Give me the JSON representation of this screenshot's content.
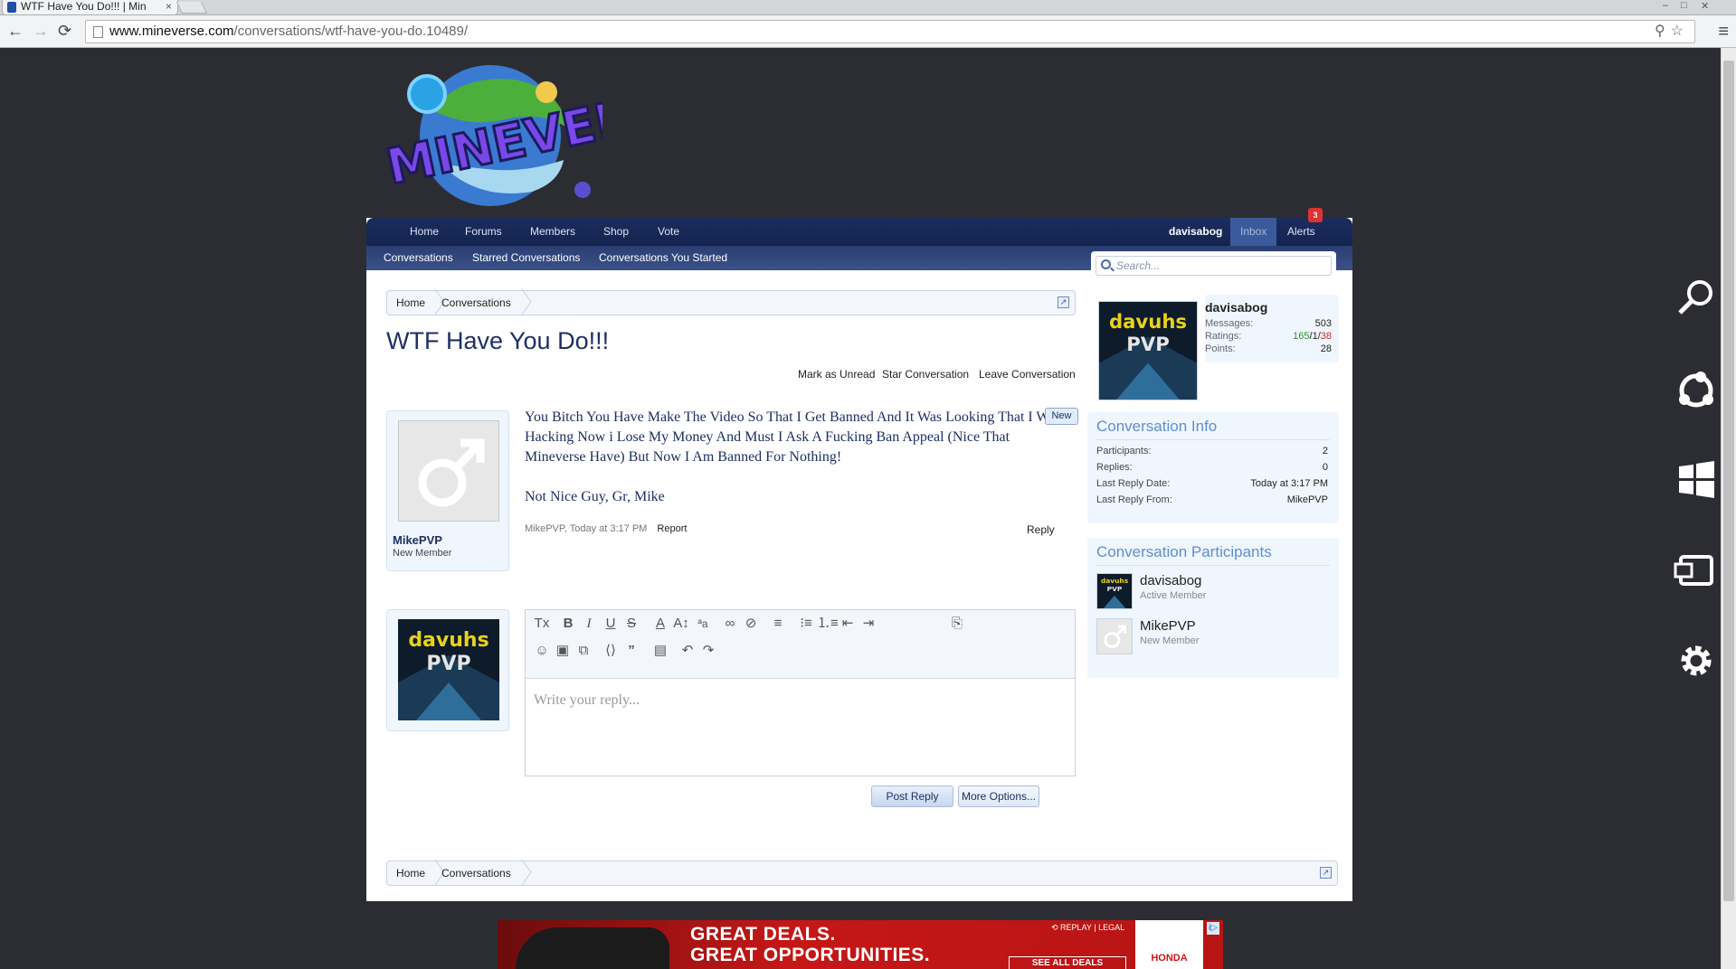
{
  "browser": {
    "tab_title": "WTF Have You Do!!! | Min",
    "tab_close": "×",
    "url_domain": "www.mineverse.com",
    "url_path": "/conversations/wtf-have-you-do.10489/",
    "back": "←",
    "forward": "→",
    "reload": "⟳",
    "menu": "≡",
    "url_icons": "⚲☆"
  },
  "site": {
    "nav": {
      "items": [
        "Home",
        "Forums",
        "Members",
        "Shop",
        "Vote"
      ],
      "user": "davisabog",
      "inbox": "Inbox",
      "alerts": "Alerts",
      "alerts_count": "3"
    },
    "subnav": [
      "Conversations",
      "Starred Conversations",
      "Conversations You Started"
    ],
    "search_placeholder": "Search...",
    "breadcrumb": [
      "Home",
      "Conversations"
    ],
    "jump": "↗",
    "title": "WTF Have You Do!!!",
    "actions": [
      "Mark as Unread",
      "Star Conversation",
      "Leave Conversation"
    ],
    "message": {
      "author": "MikePVP",
      "author_title": "New Member",
      "new_tag": "New",
      "paragraphs": [
        "You Bitch You Have Make The Video So That I Get Banned And It Was Looking That I Was Hacking Now i Lose My Money And Must I Ask A Fucking Ban Appeal (Nice That Mineverse Have) But Now I Am Banned For Nothing!",
        "Not Nice Guy, Gr, Mike"
      ],
      "meta": "MikePVP, Today at 3:17 PM",
      "report": "Report",
      "reply": "Reply"
    },
    "editor": {
      "placeholder": "Write your reply...",
      "post_reply": "Post Reply",
      "more_options": "More Options..."
    },
    "profile": {
      "name": "davisabog",
      "messages_label": "Messages:",
      "messages": "503",
      "ratings_label": "Ratings:",
      "ratings_pos": "165",
      "ratings_sep1": "/",
      "ratings_mid": "1",
      "ratings_sep2": "/",
      "ratings_neg": "38",
      "points_label": "Points:",
      "points": "28"
    },
    "conversation_info": {
      "title": "Conversation Info",
      "rows": [
        {
          "k": "Participants:",
          "v": "2"
        },
        {
          "k": "Replies:",
          "v": "0"
        },
        {
          "k": "Last Reply Date:",
          "v": "Today at 3:17 PM"
        },
        {
          "k": "Last Reply From:",
          "v": "MikePVP"
        }
      ]
    },
    "participants": {
      "title": "Conversation Participants",
      "list": [
        {
          "name": "davisabog",
          "title": "Active Member"
        },
        {
          "name": "MikePVP",
          "title": "New Member"
        }
      ]
    }
  },
  "ad": {
    "headline1": "GREAT DEALS.",
    "headline2": "GREAT OPPORTUNITIES.",
    "replay_legal": "⟲ REPLAY | LEGAL",
    "see_all": "SEE ALL DEALS",
    "brand": "HONDA",
    "info": "i▷"
  },
  "colors": {
    "nav_dark": "#14244f",
    "link_blue": "#1e2f63",
    "sidebar_heading": "#5f8fcf",
    "alert_red": "#e03232"
  }
}
